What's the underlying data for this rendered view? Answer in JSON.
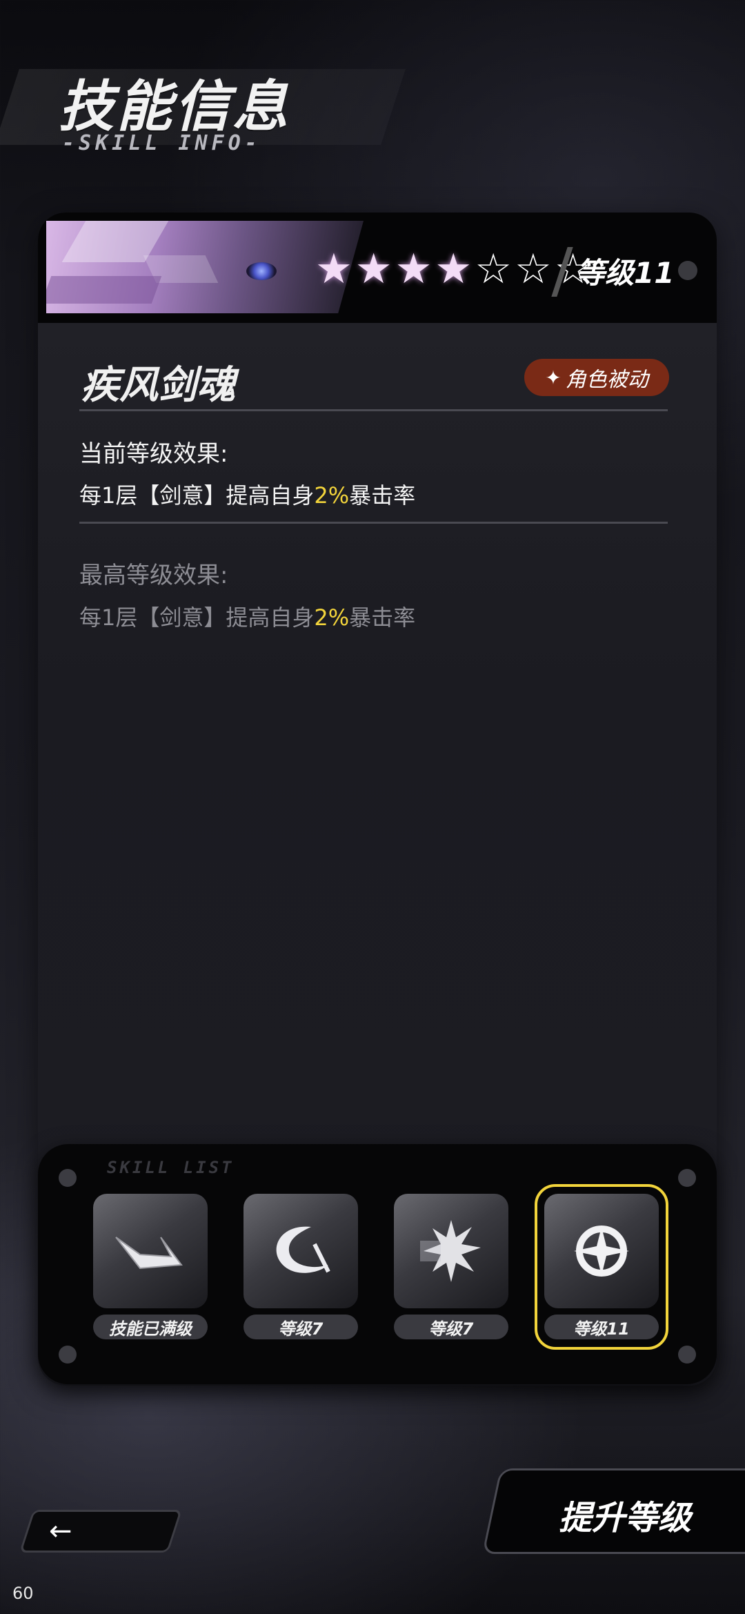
{
  "header": {
    "title": "技能信息",
    "subtitle": "-SKILL INFO-"
  },
  "card": {
    "stars_total": 7,
    "stars_filled": 4,
    "level_label": "等级11",
    "skill_name": "疾风剑魂",
    "tag": {
      "icon": "star-dash-icon",
      "label": "角色被动",
      "color": "#7a2a16"
    },
    "current": {
      "title": "当前等级效果:",
      "text_before": "每1层【剑意】提高自身",
      "highlight": "2%",
      "text_after": "暴击率"
    },
    "max": {
      "title": "最高等级效果:",
      "text_before": "每1层【剑意】提高自身",
      "highlight": "2%",
      "text_after": "暴击率"
    }
  },
  "skill_list": {
    "title": "SKILL LIST",
    "slots": [
      {
        "icon": "wing-emblem-icon",
        "label": "技能已满级",
        "selected": false
      },
      {
        "icon": "crescent-slash-icon",
        "label": "等级7",
        "selected": false
      },
      {
        "icon": "spiky-burst-icon",
        "label": "等级7",
        "selected": false
      },
      {
        "icon": "compass-star-icon",
        "label": "等级11",
        "selected": true
      }
    ]
  },
  "footer": {
    "back_icon": "left-arrow-icon",
    "upgrade_label": "提升等级",
    "fps": "60"
  },
  "colors": {
    "highlight": "#f2d43b",
    "selected_border": "#f2d43b"
  }
}
